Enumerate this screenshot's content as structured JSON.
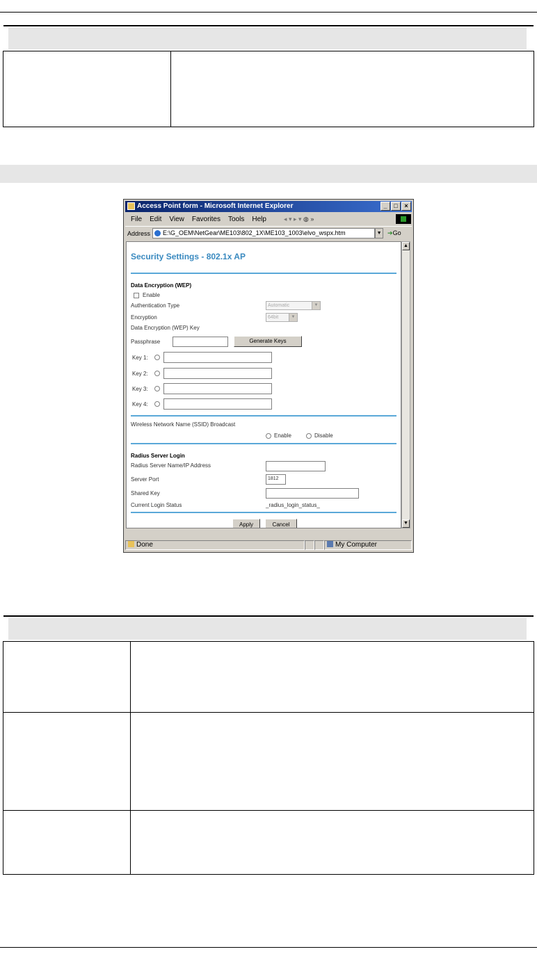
{
  "window": {
    "title": "Access Point form - Microsoft Internet Explorer",
    "menu": [
      "File",
      "Edit",
      "View",
      "Favorites",
      "Tools",
      "Help"
    ],
    "address_label": "Address",
    "address_value": "E:\\G_OEM\\NetGear\\ME103\\802_1X\\ME103_1003\\elvo_wspx.htm",
    "go_label": "Go",
    "status_text": "Done",
    "zone_text": "My Computer"
  },
  "form": {
    "title": "Security Settings - 802.1x AP",
    "wep_heading": "Data Encryption (WEP)",
    "enable_label": "Enable",
    "auth_type_label": "Authentication Type",
    "auth_type_value": "Automatic",
    "encryption_label": "Encryption",
    "encryption_value": "64bit",
    "wep_key_label": "Data Encryption (WEP) Key",
    "passphrase_label": "Passphrase",
    "generate_keys_label": "Generate Keys",
    "keys": [
      "Key 1:",
      "Key 2:",
      "Key 3:",
      "Key 4:"
    ],
    "ssid_label": "Wireless Network Name (SSID) Broadcast",
    "ssid_enable": "Enable",
    "ssid_disable": "Disable",
    "radius_heading": "Radius Server Login",
    "radius_name_label": "Radius Server Name/IP Address",
    "server_port_label": "Server Port",
    "server_port_value": "1812",
    "shared_key_label": "Shared Key",
    "login_status_label": "Current Login Status",
    "login_status_value": "_radius_login_status_",
    "apply_label": "Apply",
    "cancel_label": "Cancel"
  }
}
